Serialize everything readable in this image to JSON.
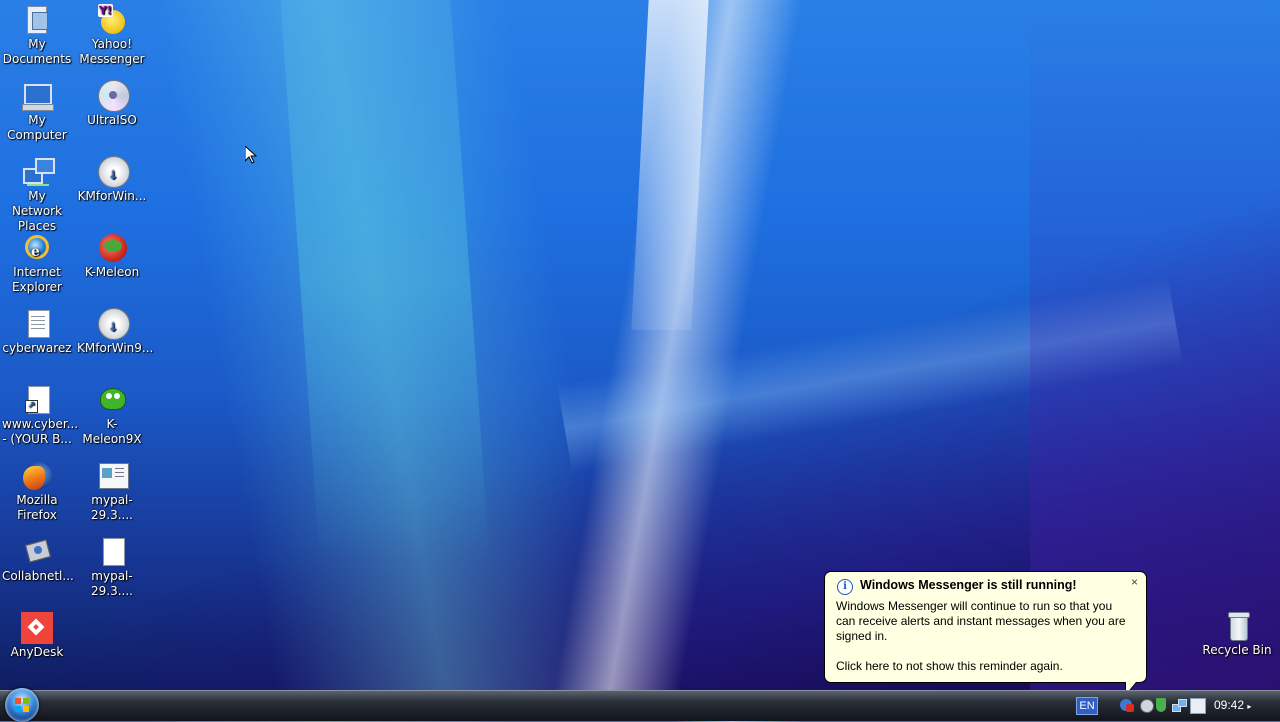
{
  "desktop": {
    "icons_left": [
      {
        "label": "My Documents",
        "icon": "my-documents-icon"
      },
      {
        "label": "My Computer",
        "icon": "my-computer-icon"
      },
      {
        "label": "My Network Places",
        "icon": "network-places-icon"
      },
      {
        "label": "Internet Explorer",
        "icon": "internet-explorer-icon"
      },
      {
        "label": "cyberwarez",
        "icon": "text-file-icon"
      },
      {
        "label": "www.cyber... - (YOUR B...",
        "icon": "shortcut-file-icon"
      },
      {
        "label": "Mozilla Firefox",
        "icon": "firefox-icon"
      },
      {
        "label": "Collabnetl...",
        "icon": "collabnet-icon"
      },
      {
        "label": "AnyDesk",
        "icon": "anydesk-icon"
      }
    ],
    "icons_right": [
      {
        "label": "Yahoo! Messenger",
        "icon": "yahoo-messenger-icon"
      },
      {
        "label": "UltraISO",
        "icon": "ultraiso-disc-icon"
      },
      {
        "label": "KMforWin...",
        "icon": "installer-disc-icon"
      },
      {
        "label": "K-Meleon",
        "icon": "k-meleon-icon"
      },
      {
        "label": "KMforWin9...",
        "icon": "installer-disc-icon"
      },
      {
        "label": "K-Meleon9X",
        "icon": "k-meleon-9x-icon"
      },
      {
        "label": "mypal-29.3....",
        "icon": "mypal-window-icon"
      },
      {
        "label": "mypal-29.3....",
        "icon": "blank-file-icon"
      }
    ],
    "recycle_bin": {
      "label": "Recycle Bin",
      "icon": "recycle-bin-icon"
    }
  },
  "balloon": {
    "title": "Windows Messenger is still running!",
    "body": "Windows Messenger will continue to run so that you can receive alerts and instant messages when you are signed in.",
    "reminder": "Click here to not show this reminder again.",
    "close": "×"
  },
  "taskbar": {
    "language": "EN",
    "clock": "09:42",
    "clock_suffix": "▸"
  },
  "colors": {
    "balloon_bg": "#ffffe1",
    "desktop_blue": "#1e6fe0",
    "anydesk_red": "#ef443b"
  }
}
